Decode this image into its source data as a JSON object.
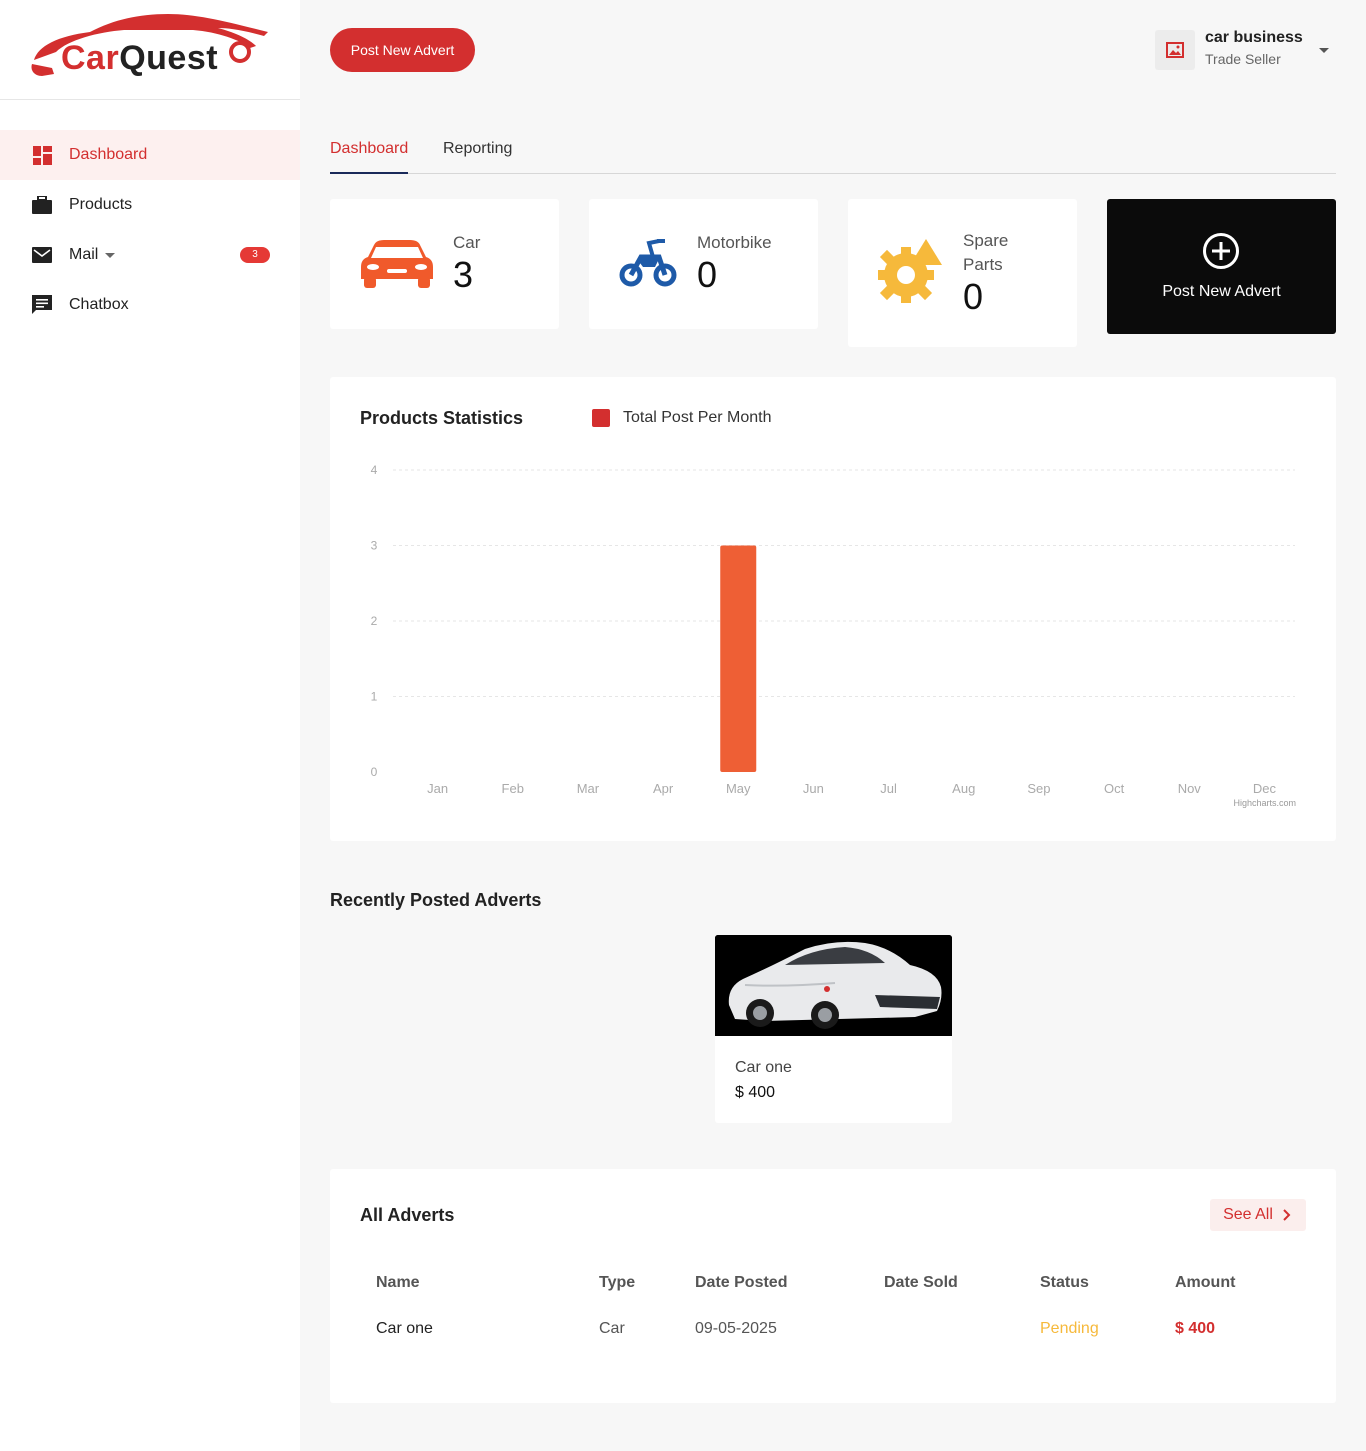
{
  "brand": {
    "name_part1": "Car",
    "name_part2": "Quest",
    "color": "#d32f2f"
  },
  "sidebar": {
    "items": [
      {
        "label": "Dashboard",
        "icon": "dashboard-icon",
        "active": true
      },
      {
        "label": "Products",
        "icon": "briefcase-icon"
      },
      {
        "label": "Mail",
        "icon": "mail-icon",
        "badge": "3"
      },
      {
        "label": "Chatbox",
        "icon": "chat-icon"
      }
    ]
  },
  "header": {
    "post_button": "Post New Advert",
    "user": {
      "name": "car business",
      "role": "Trade Seller"
    }
  },
  "tabs": [
    {
      "label": "Dashboard",
      "active": true
    },
    {
      "label": "Reporting"
    }
  ],
  "stats": [
    {
      "label": "Car",
      "value": "3",
      "icon": "car-icon",
      "color": "#f05a2b"
    },
    {
      "label": "Motorbike",
      "value": "0",
      "icon": "motorbike-icon",
      "color": "#1e5aa8"
    },
    {
      "label": "Spare Parts",
      "value": "0",
      "icon": "spare-parts-icon",
      "color": "#f6b93b"
    }
  ],
  "post_card": {
    "label": "Post New Advert",
    "icon": "plus-circle-icon"
  },
  "chart": {
    "title": "Products Statistics",
    "credits": "Highcharts.com"
  },
  "chart_data": {
    "type": "bar",
    "categories": [
      "Jan",
      "Feb",
      "Mar",
      "Apr",
      "May",
      "Jun",
      "Jul",
      "Aug",
      "Sep",
      "Oct",
      "Nov",
      "Dec"
    ],
    "series": [
      {
        "name": "Total Post Per Month",
        "values": [
          0,
          0,
          0,
          0,
          3,
          0,
          0,
          0,
          0,
          0,
          0,
          0
        ],
        "color": "#ee5f35",
        "legend_color": "#d32f2f"
      }
    ],
    "ylim": [
      0,
      4
    ],
    "yticks": [
      0,
      1,
      2,
      3,
      4
    ],
    "grid": true,
    "legend_position": "top"
  },
  "recent": {
    "title": "Recently Posted Adverts",
    "items": [
      {
        "name": "Car one",
        "price": "$ 400"
      }
    ]
  },
  "all_adverts": {
    "title": "All Adverts",
    "see_all": "See All",
    "columns": [
      "Name",
      "Type",
      "Date Posted",
      "Date Sold",
      "Status",
      "Amount"
    ],
    "rows": [
      {
        "name": "Car one",
        "type": "Car",
        "date_posted": "09-05-2025",
        "date_sold": "",
        "status": "Pending",
        "amount": "$ 400"
      }
    ],
    "status_color": "#f6b93b",
    "amount_color": "#d32f2f"
  }
}
